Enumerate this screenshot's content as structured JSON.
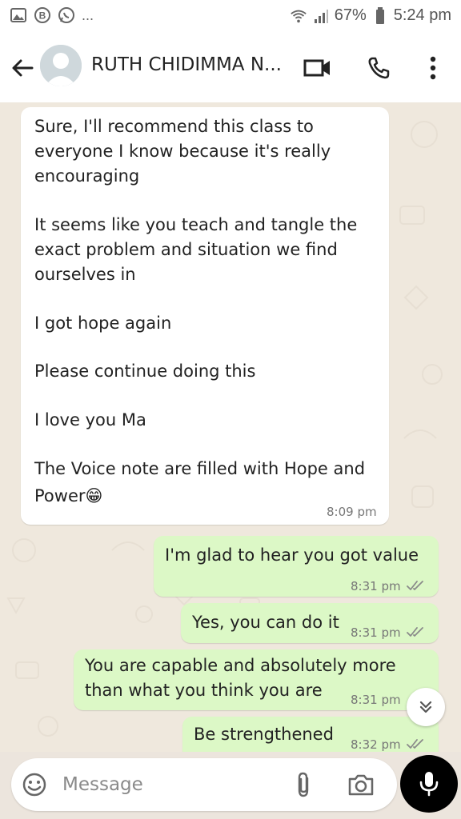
{
  "status_bar": {
    "left_icons": [
      "gallery-icon",
      "b-badge-icon",
      "whatsapp-icon"
    ],
    "left_more": "...",
    "battery": "67%",
    "time": "5:24 pm"
  },
  "header": {
    "contact_name": "RUTH CHIDIMMA N..."
  },
  "messages": [
    {
      "direction": "incoming",
      "lines": [
        "Sure, I'll recommend this class to",
        "everyone I know because it's really",
        "encouraging",
        "It seems like you teach and tangle the",
        "exact problem and situation we find",
        "ourselves in",
        "I got hope again",
        "Please continue doing this",
        "I love you Ma",
        "The Voice note are filled with Hope and",
        "Power😁"
      ],
      "time": "8:09 pm"
    },
    {
      "direction": "outgoing",
      "lines": [
        "I'm glad to hear you got value"
      ],
      "time": "8:31 pm",
      "status": "read"
    },
    {
      "direction": "outgoing",
      "lines": [
        "Yes, you can do it"
      ],
      "time": "8:31 pm",
      "status": "read"
    },
    {
      "direction": "outgoing",
      "lines": [
        "You are capable and absolutely more",
        "than what you think you are"
      ],
      "time": "8:31 pm",
      "status": "read"
    },
    {
      "direction": "outgoing",
      "lines": [
        "Be strengthened"
      ],
      "time": "8:32 pm",
      "status": "read"
    }
  ],
  "composer": {
    "placeholder": "Message"
  },
  "colors": {
    "incoming_bubble": "#ffffff",
    "outgoing_bubble": "#dcf8c6",
    "chat_background": "#efe8dd",
    "read_ticks": "#8a8a8a",
    "mic_button": "#000000"
  }
}
